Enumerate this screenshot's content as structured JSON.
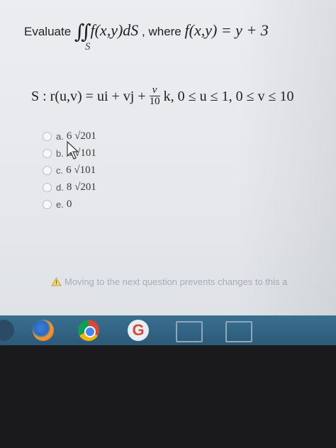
{
  "question": {
    "prefix": "Evaluate",
    "integral_symbol": "∬",
    "integrand": "f(x,y)dS",
    "connector": ", where",
    "definition": "f(x,y) = y + 3",
    "region_label": "S",
    "surface_prefix": "S : r(u,v) = ui + vj +",
    "frac_num": "v",
    "frac_den": "10",
    "surface_suffix": "k, 0 ≤ u ≤ 1, 0 ≤ v ≤ 10"
  },
  "choices": [
    {
      "letter": "a.",
      "value": "6 √201"
    },
    {
      "letter": "b.",
      "value": "8 √101"
    },
    {
      "letter": "c.",
      "value": "6 √101"
    },
    {
      "letter": "d.",
      "value": "8 √201"
    },
    {
      "letter": "e.",
      "value": "0"
    }
  ],
  "warning": {
    "icon": "warning-triangle-icon",
    "text": "Moving to the next question prevents changes to this a"
  },
  "taskbar": {
    "icons": [
      "windows-start-icon",
      "firefox-icon",
      "chrome-icon",
      "google-icon",
      "window-icon",
      "window-icon"
    ]
  }
}
